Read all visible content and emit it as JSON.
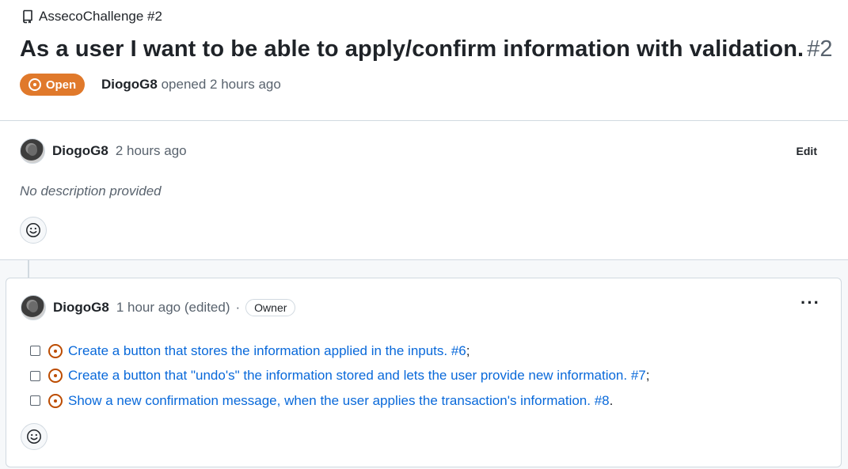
{
  "header": {
    "repo_name": "AssecoChallenge #2",
    "title": "As a user I want to be able to apply/confirm information with validation.",
    "issue_number": "#2",
    "state": "Open",
    "author": "DiogoG8",
    "opened_text": "opened 2 hours ago"
  },
  "first_comment": {
    "author": "DiogoG8",
    "time": "2 hours ago",
    "edit_label": "Edit",
    "body": "No description provided"
  },
  "second_comment": {
    "author": "DiogoG8",
    "time": "1 hour ago (edited)",
    "separator": "·",
    "role_badge": "Owner",
    "more_label": "···",
    "tasks": [
      {
        "text": "Create a button that stores the information applied in the inputs. #6",
        "suffix": " ;"
      },
      {
        "text": "Create a button that \"undo's\" the information stored and lets the user provide new information. #7",
        "suffix": " ;"
      },
      {
        "text": "Show a new confirmation message, when the user applies the transaction's information. #8",
        "suffix": "."
      }
    ]
  },
  "colors": {
    "open_badge": "#e0792b",
    "link": "#0969da",
    "issue_icon": "#bc4c00"
  },
  "icons": [
    "repo-icon",
    "issue-open-icon",
    "smiley-icon",
    "kebab-horizontal-icon"
  ]
}
